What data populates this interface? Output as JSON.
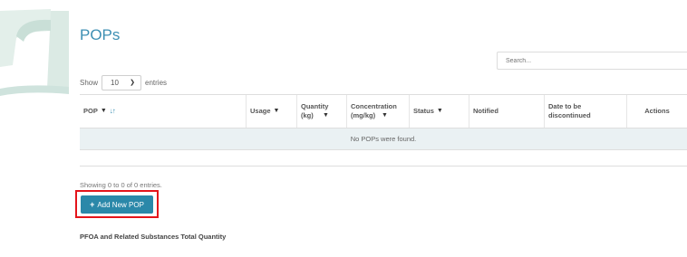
{
  "page": {
    "title": "POPs"
  },
  "search": {
    "placeholder": "Search..."
  },
  "length_menu": {
    "prefix": "Show",
    "selected": "10",
    "suffix": "entries"
  },
  "table": {
    "columns": [
      {
        "label": "POP",
        "filter_icon": "filter-icon",
        "sort_icon": "sort-icon"
      },
      {
        "label": "Usage",
        "filter_icon": "filter-icon"
      },
      {
        "label": "Quantity (kg)",
        "filter_icon": "filter-icon"
      },
      {
        "label": "Concentration (mg/kg)",
        "filter_icon": "filter-icon"
      },
      {
        "label": "Status",
        "filter_icon": "filter-icon"
      },
      {
        "label": "Notified"
      },
      {
        "label": "Date to be discontinued"
      },
      {
        "label": "Actions"
      }
    ],
    "empty_message": "No POPs were found."
  },
  "info_text": "Showing 0 to 0 of 0 entries.",
  "add_button": {
    "label": "Add New POP",
    "icon": "plus-icon"
  },
  "section_title": "PFOA and Related Substances Total Quantity",
  "colors": {
    "accent": "#3d8fb3",
    "button": "#2b88a9",
    "highlight": "#e4141b",
    "empty_row_bg": "#eaf1f3"
  }
}
